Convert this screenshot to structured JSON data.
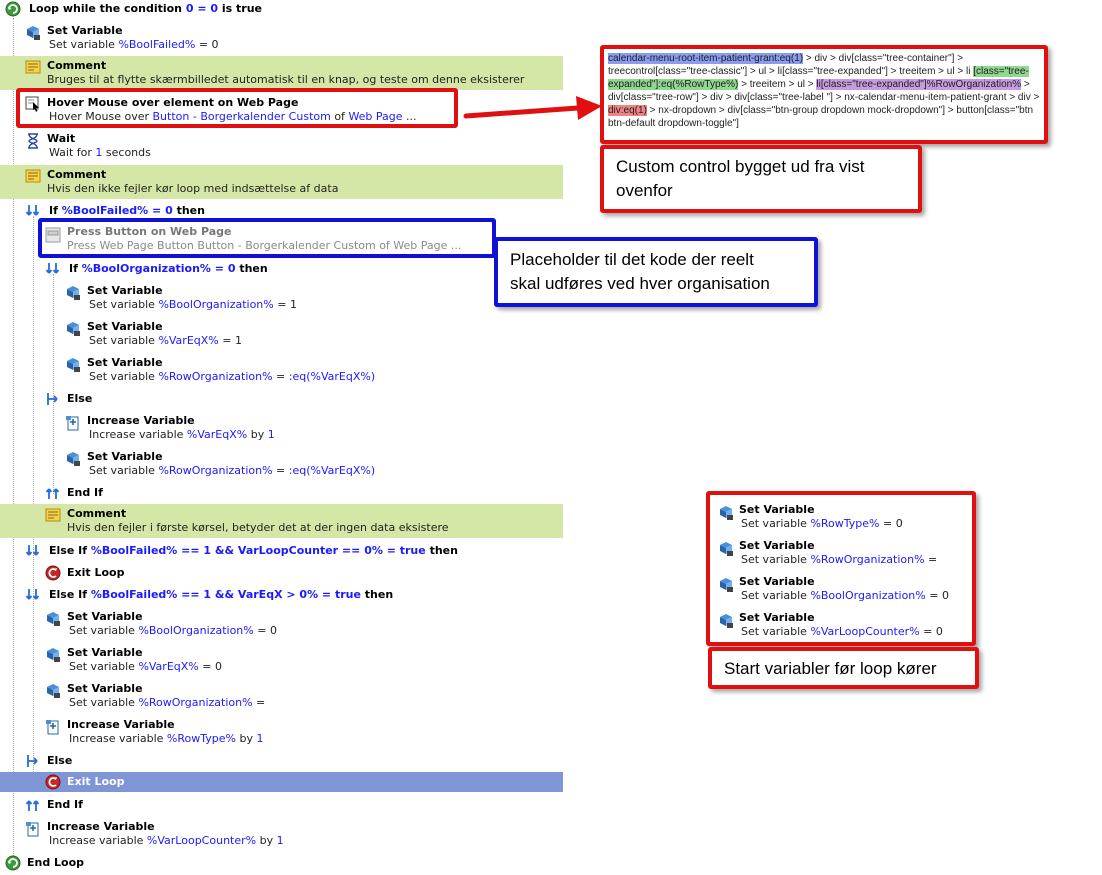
{
  "colors": {
    "comment_bg": "#d4e7a6",
    "selected_bg": "#7f95d6",
    "callout_red": "#e01010",
    "callout_blue": "#1010d8",
    "var_blue": "#1a1aff"
  },
  "steps": {
    "loop_start": {
      "prefix": "Loop while the condition ",
      "cond": "0 = 0",
      "suffix": " is true"
    },
    "s1": {
      "title": "Set Variable",
      "pre": "Set variable ",
      "var": "%BoolFailed%",
      "post": " = 0"
    },
    "c1": {
      "title": "Comment",
      "text": "Bruges til at flytte skærmbilledet automatisk til en knap, og teste om denne eksisterer"
    },
    "hover": {
      "title": "Hover Mouse over element on Web Page",
      "pre": "Hover Mouse over ",
      "target": "Button - Borgerkalender Custom",
      "mid": " of ",
      "page": "Web Page",
      "ellipsis": "  ..."
    },
    "wait": {
      "title": "Wait",
      "pre": "Wait for ",
      "num": "1",
      "post": " seconds"
    },
    "c2": {
      "title": "Comment",
      "text": "Hvis den ikke fejler kør loop med indsættelse af data"
    },
    "if1": {
      "kw": "If ",
      "cond": "%BoolFailed% = 0",
      "then": " then"
    },
    "press": {
      "title": "Press Button on Web Page",
      "text": "Press Web Page Button Button - Borgerkalender Custom of Web Page  ..."
    },
    "if2": {
      "kw": "If ",
      "cond": "%BoolOrganization% = 0",
      "then": " then"
    },
    "s2": {
      "title": "Set Variable",
      "pre": "Set variable ",
      "var": "%BoolOrganization%",
      "post": " = 1"
    },
    "s3": {
      "title": "Set Variable",
      "pre": "Set variable ",
      "var": "%VarEqX%",
      "post": " = 1"
    },
    "s4": {
      "title": "Set Variable",
      "pre": "Set variable ",
      "var": "%RowOrganization%",
      "post": " = ",
      "val": ":eq(%VarEqX%)"
    },
    "else1": {
      "title": "Else"
    },
    "inc1": {
      "title": "Increase Variable",
      "pre": "Increase variable ",
      "var": "%VarEqX%",
      "mid": " by ",
      "num": "1"
    },
    "s5": {
      "title": "Set Variable",
      "pre": "Set variable ",
      "var": "%RowOrganization%",
      "post": " = ",
      "val": ":eq(%VarEqX%)"
    },
    "endif1": {
      "title": "End If"
    },
    "c3": {
      "title": "Comment",
      "text": "Hvis den fejler i første kørsel, betyder det at der ingen data eksistere"
    },
    "elseif1": {
      "kw": "Else If ",
      "cond": "%BoolFailed% == 1 && VarLoopCounter == 0% = true",
      "then": " then"
    },
    "exit1": {
      "title": "Exit Loop"
    },
    "elseif2": {
      "kw": "Else If ",
      "cond": "%BoolFailed% == 1 && VarEqX > 0% = true",
      "then": " then"
    },
    "s6": {
      "title": "Set Variable",
      "pre": "Set variable ",
      "var": "%BoolOrganization%",
      "post": " = 0"
    },
    "s7": {
      "title": "Set Variable",
      "pre": "Set variable ",
      "var": "%VarEqX%",
      "post": " = 0"
    },
    "s8": {
      "title": "Set Variable",
      "pre": "Set variable ",
      "var": "%RowOrganization%",
      "post": " ="
    },
    "inc2": {
      "title": "Increase Variable",
      "pre": "Increase variable ",
      "var": "%RowType%",
      "mid": " by ",
      "num": "1"
    },
    "else2": {
      "title": "Else"
    },
    "exit2": {
      "title": "Exit Loop"
    },
    "endif2": {
      "title": "End If"
    },
    "inc3": {
      "title": "Increase Variable",
      "pre": "Increase variable ",
      "var": "%VarLoopCounter%",
      "mid": " by ",
      "num": "1"
    },
    "endloop": {
      "title": "End Loop"
    }
  },
  "callouts": {
    "selector": {
      "p1": "calendar-menu-root-item-patient-grant:eq(1)",
      "p2": " > div > div[class=\"tree-container\"] > treecontrol[class=\"tree-classic\"] > ul > li[class=\"tree-expanded\"] > treeitem > ul > li ",
      "p3": "[class=\"tree-expanded\"]:eq(%RowType%)",
      "p4": " > treeitem > ul > ",
      "p5": "li[class=\"tree-expanded\"]%RowOrganization%",
      "p6": " > div[class=\"tree-row\"] > div > div[class=\"tree-label \"] > nx-calendar-menu-item-patient-grant > div > ",
      "p7": "div:eq(1)",
      "p8": " > nx-dropdown > div[class=\"btn-group dropdown mock-dropdown\"] > button[class=\"btn btn-default dropdown-toggle\"]"
    },
    "custom_note": {
      "line1": "Custom control bygget ud fra vist",
      "line2": "ovenfor"
    },
    "placeholder_note": {
      "line1": "Placeholder til det kode der reelt",
      "line2": "skal udføres ved hver organisation"
    },
    "init_vars": [
      {
        "title": "Set Variable",
        "pre": "Set variable ",
        "var": "%RowType%",
        "post": " = 0"
      },
      {
        "title": "Set Variable",
        "pre": "Set variable ",
        "var": "%RowOrganization%",
        "post": " ="
      },
      {
        "title": "Set Variable",
        "pre": "Set variable ",
        "var": "%BoolOrganization%",
        "post": " = 0"
      },
      {
        "title": "Set Variable",
        "pre": "Set variable ",
        "var": "%VarLoopCounter%",
        "post": " = 0"
      }
    ],
    "init_note": "Start variabler før loop kører"
  }
}
